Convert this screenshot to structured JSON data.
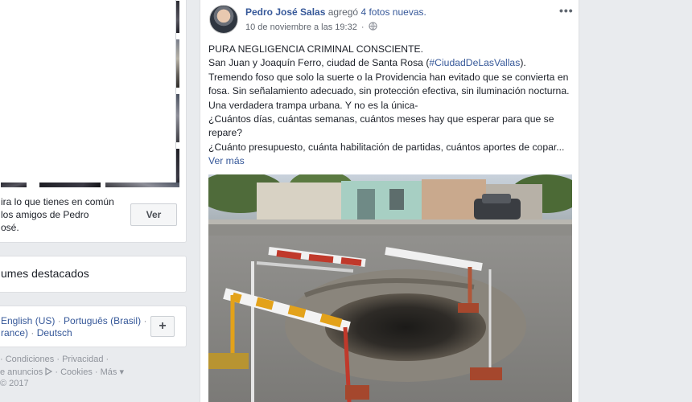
{
  "left": {
    "mutual_lines": [
      "ira lo que tienes en común",
      "los amigos de Pedro",
      "osé."
    ],
    "ver_label": "Ver",
    "albums_title": "umes destacados",
    "languages": {
      "line1": [
        "English (US)",
        "Português (Brasil)"
      ],
      "line2": [
        "rance)",
        "Deutsch"
      ],
      "add_label": "+"
    },
    "footer": {
      "line1": [
        "Condiciones",
        "Privacidad"
      ],
      "line2": [
        "e anuncios",
        "Cookies",
        "Más"
      ],
      "copyright": "© 2017"
    }
  },
  "post": {
    "author": "Pedro José Salas",
    "action": "agregó",
    "photos_link": "4 fotos nuevas.",
    "timestamp": "10 de noviembre a las 19:32",
    "more_label": "•••",
    "text": {
      "line1": "PURA NEGLIGENCIA CRIMINAL CONSCIENTE.",
      "line2_before": "San Juan y Joaquín Ferro, ciudad de Santa Rosa (",
      "hashtag": "#CiudadDeLasVallas",
      "line2_after": ").",
      "para1": "Tremendo foso que solo la suerte o la Providencia han evitado que se convierta en fosa. Sin señalamiento adecuado, sin protección efectiva, sin iluminación nocturna. Una verdadera trampa urbana. Y no es la única-",
      "para2": "¿Cuántos días, cuántas semanas, cuántos meses hay que esperar para que se repare?",
      "para3": "¿Cuánto presupuesto, cuánta habilitación de partidas, cuántos aportes de copar...",
      "see_more": "Ver más"
    }
  }
}
